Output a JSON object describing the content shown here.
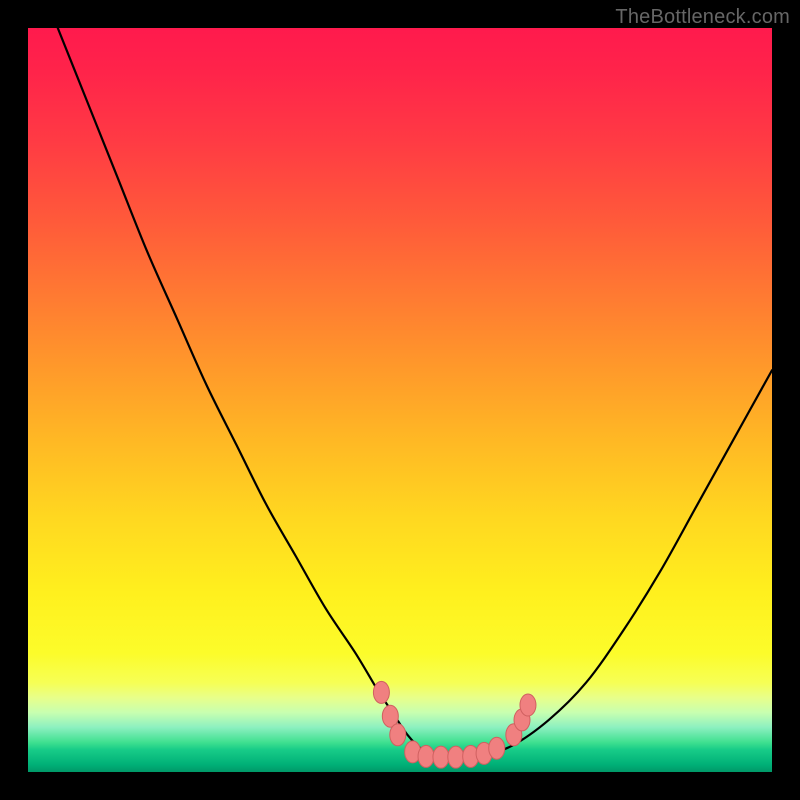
{
  "watermark": "TheBottleneck.com",
  "colors": {
    "frame": "#000000",
    "curve_stroke": "#000000",
    "marker_fill": "#f08080",
    "marker_stroke": "#d06060"
  },
  "chart_data": {
    "type": "line",
    "title": "",
    "xlabel": "",
    "ylabel": "",
    "xlim": [
      0,
      100
    ],
    "ylim": [
      0,
      100
    ],
    "grid": false,
    "legend": false,
    "series": [
      {
        "name": "bottleneck-curve",
        "x": [
          4,
          8,
          12,
          16,
          20,
          24,
          28,
          32,
          36,
          40,
          44,
          47,
          49,
          51,
          53,
          55,
          57,
          59,
          61,
          65,
          70,
          75,
          80,
          85,
          90,
          95,
          100
        ],
        "y": [
          100,
          90,
          80,
          70,
          61,
          52,
          44,
          36,
          29,
          22,
          16,
          11,
          8,
          5,
          3,
          2.2,
          2,
          2,
          2.2,
          3.5,
          7,
          12,
          19,
          27,
          36,
          45,
          54
        ]
      }
    ],
    "markers": [
      {
        "x": 47.5,
        "y": 10.7
      },
      {
        "x": 48.7,
        "y": 7.5
      },
      {
        "x": 49.7,
        "y": 5.0
      },
      {
        "x": 51.7,
        "y": 2.7
      },
      {
        "x": 53.5,
        "y": 2.1
      },
      {
        "x": 55.5,
        "y": 2.0
      },
      {
        "x": 57.5,
        "y": 2.0
      },
      {
        "x": 59.5,
        "y": 2.1
      },
      {
        "x": 61.3,
        "y": 2.5
      },
      {
        "x": 63.0,
        "y": 3.2
      },
      {
        "x": 65.3,
        "y": 5.0
      },
      {
        "x": 66.4,
        "y": 7.0
      },
      {
        "x": 67.2,
        "y": 9.0
      }
    ]
  }
}
